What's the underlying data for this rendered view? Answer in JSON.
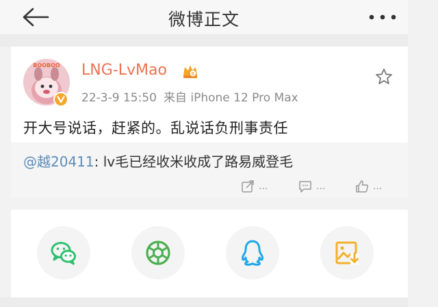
{
  "header": {
    "title": "微博正文",
    "back_icon": "arrow-left-icon",
    "more_icon": "more-dots-icon"
  },
  "post": {
    "username": "LNG-LvMao",
    "timestamp": "22-3-9 15:50",
    "source": "来自 iPhone 12 Pro Max",
    "text": "开大号说话，赶紧的。乱说话负刑事责任",
    "avatar_text": "BOOBOO",
    "verified": true,
    "username_color": "#eb7350"
  },
  "repost": {
    "mention": "@越20411",
    "text": ": lv毛已经收米收成了路易威登毛",
    "mention_color": "#5d8bb7",
    "actions": [
      {
        "icon": "share-icon",
        "label": "..."
      },
      {
        "icon": "comment-icon",
        "label": "..."
      },
      {
        "icon": "like-icon",
        "label": "..."
      }
    ]
  },
  "share": {
    "targets": [
      {
        "icon": "wechat-icon",
        "color": "#2ec06f"
      },
      {
        "icon": "moments-icon",
        "color": "#4caf50"
      },
      {
        "icon": "qq-icon",
        "color": "#1ea7e8"
      },
      {
        "icon": "save-image-icon",
        "color": "#f3b030"
      }
    ]
  }
}
